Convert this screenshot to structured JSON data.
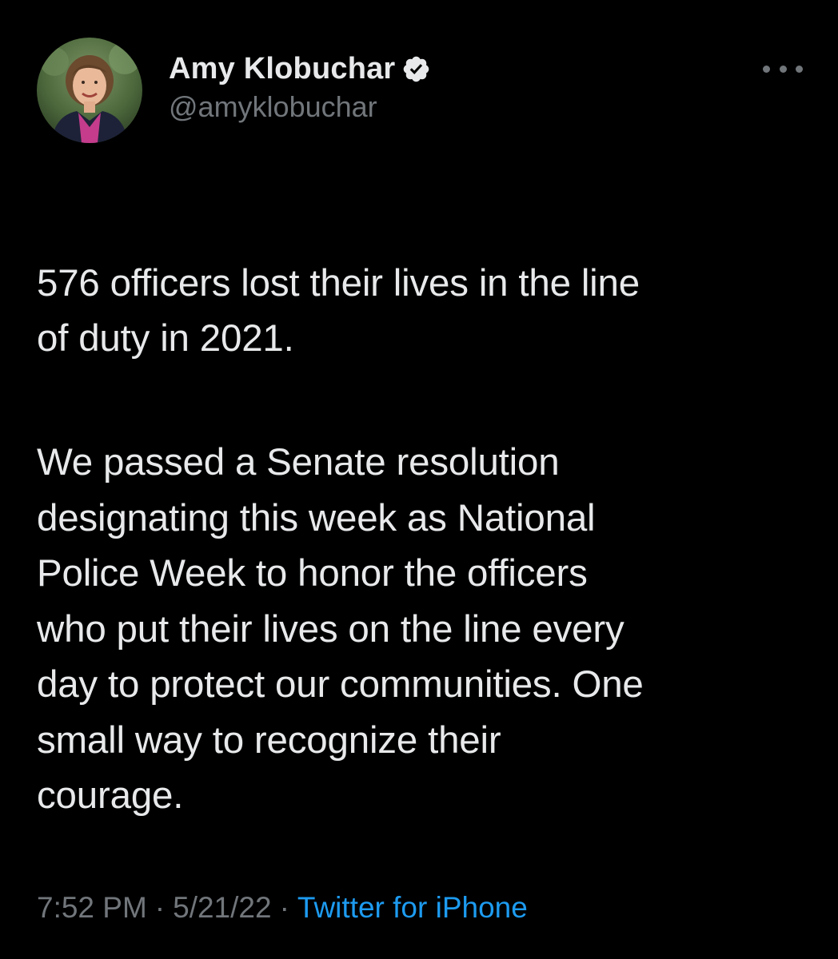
{
  "tweet": {
    "author": {
      "display_name": "Amy Klobuchar",
      "handle": "@amyklobuchar",
      "verified": true,
      "avatar_icon": "profile-photo"
    },
    "more_icon": "more-options-icon",
    "paragraphs": [
      "576 officers lost their lives in the line\nof duty in 2021.",
      "We passed a Senate resolution\ndesignating this week as National\nPolice Week to honor the officers\nwho put their lives on the line every\nday to protect our communities. One\nsmall way to recognize their\ncourage."
    ],
    "time": "7:52 PM",
    "date": "5/21/22",
    "separator": "·",
    "source": "Twitter for iPhone"
  },
  "colors": {
    "background": "#000000",
    "text": "#e7e9ea",
    "secondary": "#71767b",
    "accent": "#1d9bf0"
  }
}
